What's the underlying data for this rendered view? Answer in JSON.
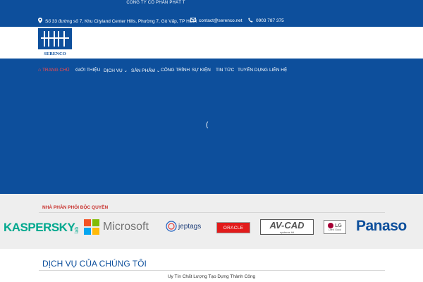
{
  "topbar": {
    "company_name": "CÔNG TY CỔ PHẦN PHÁT T",
    "address": "Số 33 đường số 7, Khu Cityland Center Hills, Phường 7, Gò Vấp, TP HCM",
    "email": "contact@serenco.net",
    "phone": "0903 787 375"
  },
  "logo": {
    "text": "SERENCO"
  },
  "nav": {
    "items": [
      {
        "label": "TRANG CHỦ"
      },
      {
        "label": "GIỚI THIỆU"
      },
      {
        "label": "DỊCH VỤ"
      },
      {
        "label": "SẢN PHẨM"
      },
      {
        "label": "CÔNG TRÌNH"
      },
      {
        "label": "SỰ KIỆN"
      },
      {
        "label": "TIN TỨC"
      },
      {
        "label": "TUYỂN DỤNG"
      },
      {
        "label": "LIÊN HỆ"
      }
    ]
  },
  "slider": {
    "arrow": "("
  },
  "distributor": {
    "title": "NHÀ PHÂN PHỐI ĐỘC QUYỀN",
    "brands": {
      "kaspersky": "KASPERSKY",
      "kaspersky_lab": "lab",
      "microsoft": "Microsoft",
      "jeptags": "jeptags",
      "oracle": "ORACLE",
      "avcad": "AV-CAD",
      "avcad_sub": "systems ltd",
      "lg": "LG",
      "lg_sub": "Life's Good",
      "panasonic": "Panaso"
    }
  },
  "services": {
    "title": "DỊCH VỤ CỦA CHÚNG TÔI",
    "subtitle": "Uy Tín Chất Lượng Tạo Dựng Thành Công"
  },
  "colors": {
    "primary": "#0d4f9c",
    "accent": "#c8302c"
  }
}
